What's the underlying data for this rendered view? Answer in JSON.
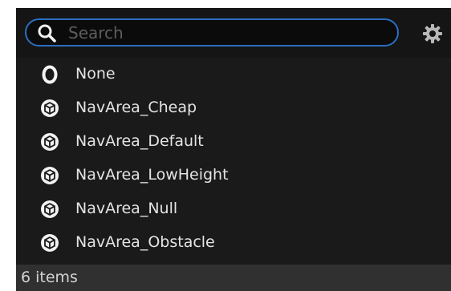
{
  "search": {
    "placeholder": "Search",
    "value": "",
    "border_color": "#2a6fc1"
  },
  "toolbar": {
    "settings_icon": "gear-icon"
  },
  "items": [
    {
      "label": "None",
      "icon": "ring-icon"
    },
    {
      "label": "NavArea_Cheap",
      "icon": "cube-icon"
    },
    {
      "label": "NavArea_Default",
      "icon": "cube-icon"
    },
    {
      "label": "NavArea_LowHeight",
      "icon": "cube-icon"
    },
    {
      "label": "NavArea_Null",
      "icon": "cube-icon"
    },
    {
      "label": "NavArea_Obstacle",
      "icon": "cube-icon"
    }
  ],
  "footer": {
    "count": "6 items"
  },
  "colors": {
    "panel_bg": "#1a1a1a",
    "footer_bg": "#303030",
    "text": "#e4e4e4",
    "accent": "#2a6fc1"
  }
}
